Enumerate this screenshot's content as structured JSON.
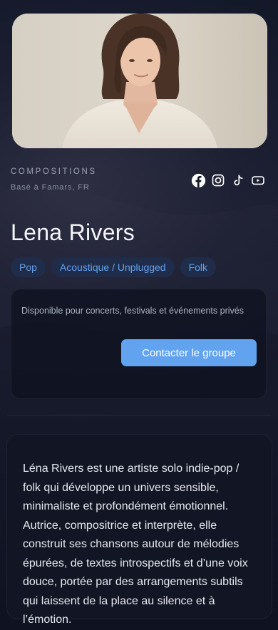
{
  "artist": {
    "kicker": "COMPOSITIONS",
    "location": "Basé à Famars, FR",
    "name": "Lena Rivers",
    "photo_alt": "Portrait of Lena Rivers"
  },
  "socials": [
    {
      "icon": "facebook-icon"
    },
    {
      "icon": "instagram-icon"
    },
    {
      "icon": "tiktok-icon"
    },
    {
      "icon": "youtube-icon"
    }
  ],
  "tags": [
    "Pop",
    "Acoustique / Unplugged",
    "Folk"
  ],
  "booking": {
    "availability": "Disponible pour concerts, festivals et événements privés",
    "cta_label": "Contacter le groupe"
  },
  "bio": {
    "text": "Léna Rivers est une artiste solo indie-pop / folk qui développe un univers sensible, minimaliste et profondément émotionnel. Autrice, compositrice et interprète, elle construit ses chansons autour de mélodies épurées, de textes introspectifs et d’une voix douce, portée par des arrangements subtils qui laissent de la place au silence et à l’émotion."
  },
  "colors": {
    "accent": "#62a3f0",
    "tag_bg": "#1f2d4a",
    "tag_text": "#62a1ee",
    "background": "#0e1221"
  }
}
